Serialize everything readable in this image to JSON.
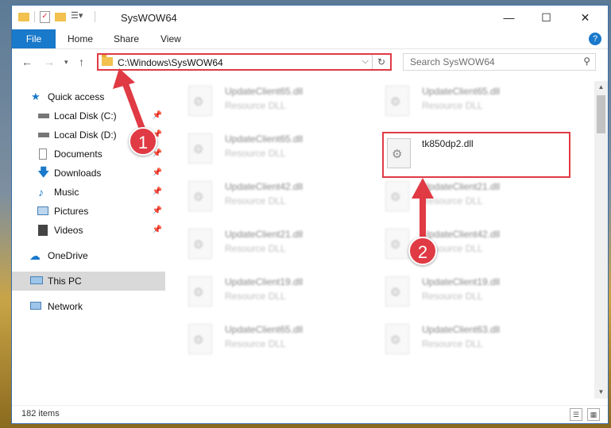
{
  "window": {
    "title": "SysWOW64",
    "controls": [
      "—",
      "☐",
      "✕"
    ]
  },
  "ribbon": {
    "tabs": [
      "File",
      "Home",
      "Share",
      "View"
    ],
    "help": "?"
  },
  "address": {
    "path": "C:\\Windows\\SysWOW64",
    "refresh": "↻"
  },
  "search": {
    "placeholder": "Search SysWOW64"
  },
  "sidebar": {
    "items": [
      {
        "label": "Quick access",
        "icon": "star-icon",
        "pinned": false
      },
      {
        "label": "Local Disk (C:)",
        "icon": "drive-icon",
        "pinned": true
      },
      {
        "label": "Local Disk (D:)",
        "icon": "drive-icon",
        "pinned": true
      },
      {
        "label": "Documents",
        "icon": "documents-icon",
        "pinned": true
      },
      {
        "label": "Downloads",
        "icon": "downloads-icon",
        "pinned": true
      },
      {
        "label": "Music",
        "icon": "music-icon",
        "pinned": true
      },
      {
        "label": "Pictures",
        "icon": "pictures-icon",
        "pinned": true
      },
      {
        "label": "Videos",
        "icon": "videos-icon",
        "pinned": true
      },
      {
        "label": "OneDrive",
        "icon": "cloud-icon",
        "pinned": false
      },
      {
        "label": "This PC",
        "icon": "computer-icon",
        "pinned": false
      },
      {
        "label": "Network",
        "icon": "network-icon",
        "pinned": false
      }
    ]
  },
  "files": [
    {
      "name": "UpdateClient65.dll",
      "type": "Resource DLL"
    },
    {
      "name": "UpdateClient65.dll",
      "type": "Resource DLL"
    },
    {
      "name": "UpdateClient65.dll",
      "type": "Resource DLL"
    },
    {
      "name": "tk850dp2.dll",
      "type": ""
    },
    {
      "name": "UpdateClient42.dll",
      "type": "Resource DLL"
    },
    {
      "name": "UpdateClient21.dll",
      "type": "Resource DLL"
    },
    {
      "name": "UpdateClient21.dll",
      "type": "Resource DLL"
    },
    {
      "name": "UpdateClient42.dll",
      "type": "Resource DLL"
    },
    {
      "name": "UpdateClient19.dll",
      "type": "Resource DLL"
    },
    {
      "name": "UpdateClient19.dll",
      "type": "Resource DLL"
    },
    {
      "name": "UpdateClient65.dll",
      "type": "Resource DLL"
    },
    {
      "name": "UpdateClient63.dll",
      "type": "Resource DLL"
    }
  ],
  "status": {
    "item_count": "182 items"
  },
  "annotations": {
    "step1": "1",
    "step2": "2"
  },
  "colors": {
    "accent": "#1979ca",
    "highlight": "#e03a44"
  }
}
